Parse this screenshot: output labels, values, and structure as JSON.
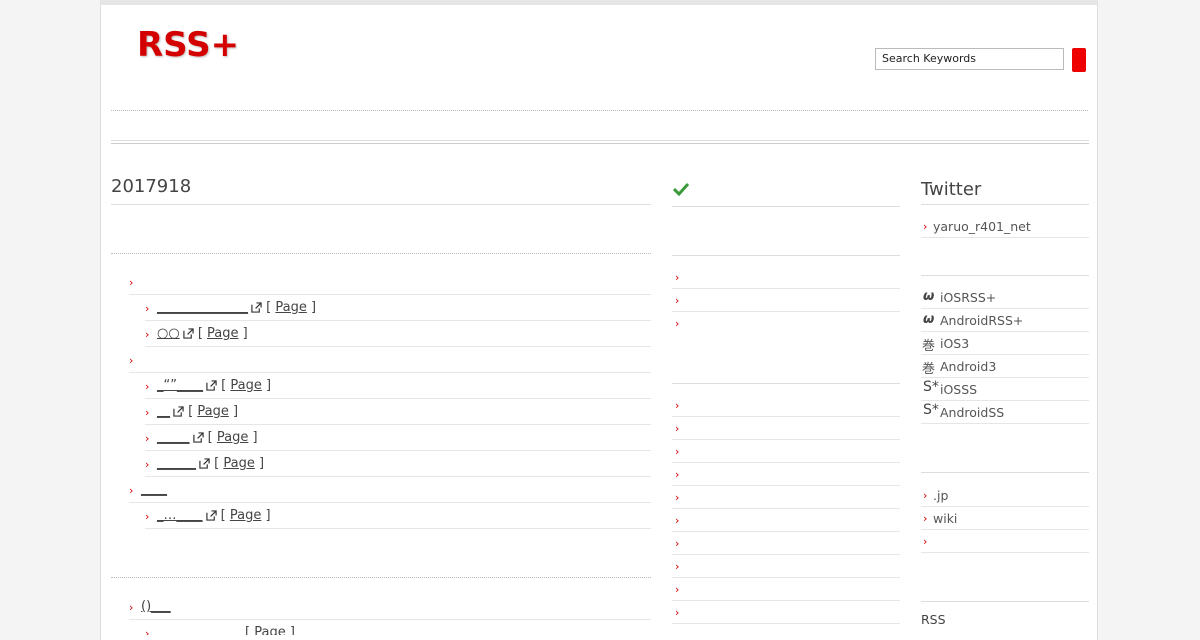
{
  "site": {
    "logo": "RSS+"
  },
  "search": {
    "value": "Search Keywords"
  },
  "main": {
    "date_heading": "2017918",
    "page_link_label": "Page",
    "items": [
      {
        "label": "",
        "children": [
          {
            "label": "______________",
            "link": "Page"
          },
          {
            "label": "○○",
            "link": "Page"
          }
        ]
      },
      {
        "label": "",
        "children": [
          {
            "label": "_“”____",
            "link": "Page"
          },
          {
            "label": "__",
            "link": "Page"
          },
          {
            "label": "_____",
            "link": "Page"
          },
          {
            "label": "______",
            "link": "Page"
          }
        ]
      },
      {
        "label": "____",
        "children": [
          {
            "label": "_…____",
            "link": "Page"
          }
        ]
      }
    ],
    "lower_item": {
      "label": "()___",
      "child_link": "Page"
    }
  },
  "middle": {
    "check_icon": "check-icon"
  },
  "sidebar": {
    "twitter_heading": "Twitter",
    "twitter_account": "yaruo_r401_net",
    "apps": [
      {
        "icon": "ω",
        "label": "iOSRSS+"
      },
      {
        "icon": "ω",
        "label": "AndroidRSS+"
      },
      {
        "icon": "巻",
        "label": "iOS3"
      },
      {
        "icon": "巻",
        "label": "Android3"
      },
      {
        "icon": "S*",
        "label": "iOSSS"
      },
      {
        "icon": "S*",
        "label": "AndroidSS"
      }
    ],
    "links": [
      {
        "label": ".jp"
      },
      {
        "label": "wiki"
      },
      {
        "label": ""
      }
    ],
    "rss_label": "RSS"
  },
  "colors": {
    "accent": "#d40000",
    "search_button": "#ee0000"
  }
}
